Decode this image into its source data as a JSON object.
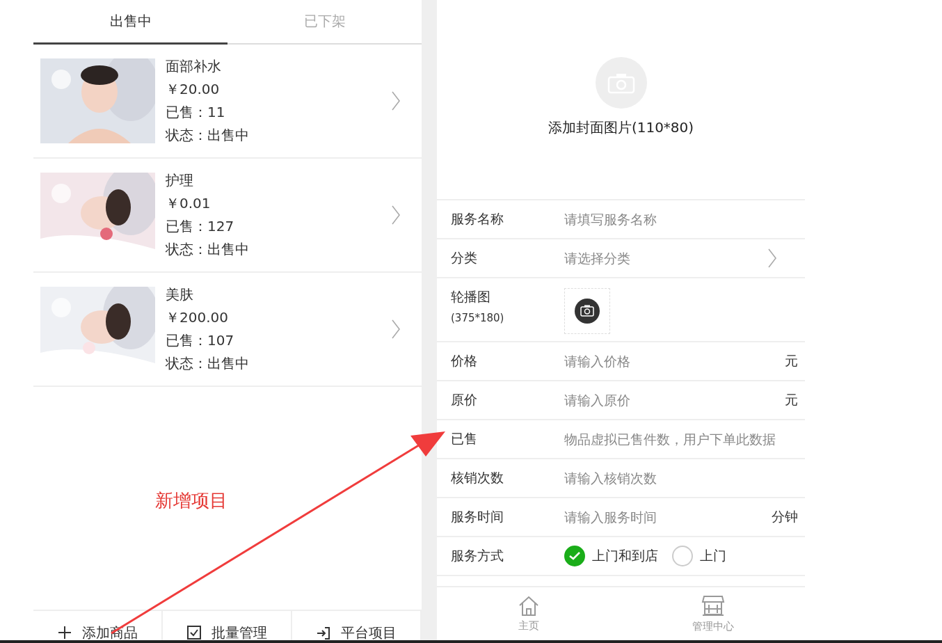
{
  "tabs": [
    {
      "label": "出售中",
      "selected": true
    },
    {
      "label": "已下架",
      "selected": false
    }
  ],
  "products": [
    {
      "name": "面部补水",
      "price": "￥20.00",
      "sold": "已售：11",
      "status": "状态：出售中"
    },
    {
      "name": "护理",
      "price": "￥0.01",
      "sold": "已售：127",
      "status": "状态：出售中"
    },
    {
      "name": "美肤",
      "price": "￥200.00",
      "sold": "已售：107",
      "status": "状态：出售中"
    }
  ],
  "toolbar": [
    {
      "kind": "add",
      "label": "添加商品"
    },
    {
      "kind": "batch",
      "label": "批量管理"
    },
    {
      "kind": "platform",
      "label": "平台项目"
    }
  ],
  "annotation": "新增项目",
  "cover": {
    "label": "添加封面图片(110*80)"
  },
  "form": [
    {
      "kind": "input",
      "label": "服务名称",
      "placeholder": "请填写服务名称"
    },
    {
      "kind": "select",
      "label": "分类",
      "placeholder": "请选择分类"
    },
    {
      "label": "轮播图",
      "hint": "(375*180)"
    },
    {
      "kind": "input",
      "label": "价格",
      "placeholder": "请输入价格",
      "unit": "元"
    },
    {
      "kind": "input",
      "label": "原价",
      "placeholder": "请输入原价",
      "unit": "元"
    },
    {
      "kind": "input",
      "label": "已售",
      "placeholder": "物品虚拟已售件数，用户下单此数据"
    },
    {
      "kind": "input",
      "label": "核销次数",
      "placeholder": "请输入核销次数"
    },
    {
      "kind": "input",
      "label": "服务时间",
      "placeholder": "请输入服务时间",
      "unit": "分钟"
    },
    {
      "kind": "radio",
      "label": "服务方式",
      "options": [
        {
          "label": "上门和到店",
          "selected": true
        },
        {
          "label": "上门",
          "selected": false
        }
      ]
    }
  ],
  "bottom_nav": [
    {
      "kind": "home",
      "label": "主页"
    },
    {
      "kind": "store",
      "label": "管理中心"
    }
  ]
}
